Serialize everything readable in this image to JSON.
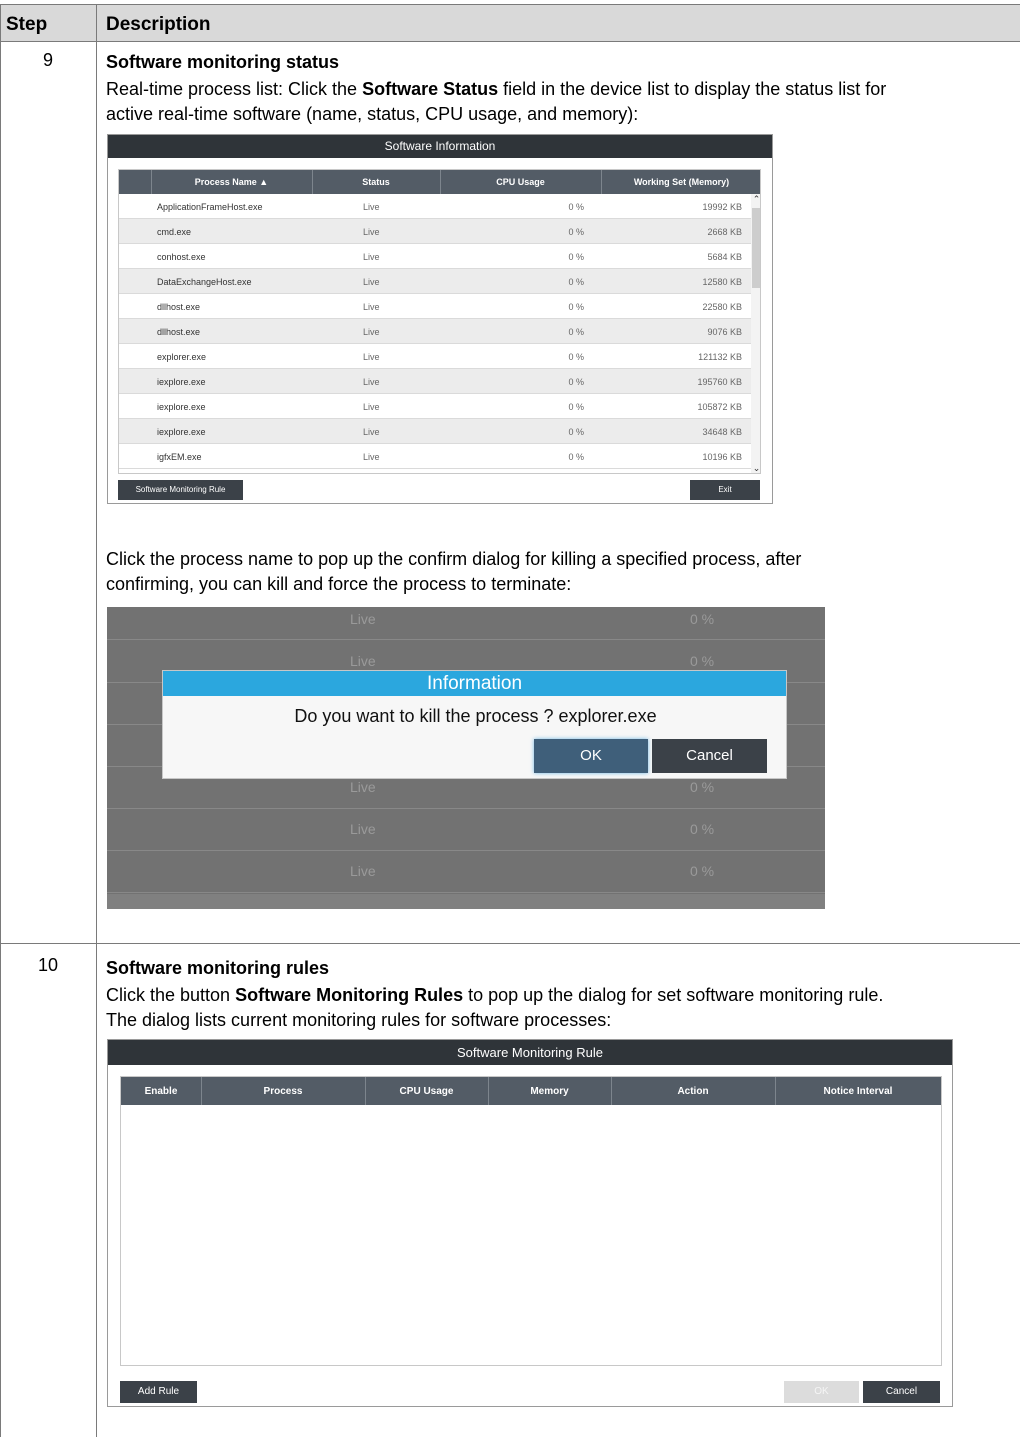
{
  "table_header": {
    "step": "Step",
    "description": "Description"
  },
  "step9": {
    "number": "9",
    "title": "Software monitoring status",
    "p1_a": "Real-time process list: Click the ",
    "p1_b": "Software Status",
    "p1_c": " field in the device list to display the status list for",
    "p1_d": "active real-time software (name, status, CPU usage, and memory):",
    "p2_a": "Click the process name to pop up the confirm dialog for killing a specified process, after",
    "p2_b": "confirming, you can kill and force the process to terminate:"
  },
  "software_info": {
    "title": "Software Information",
    "columns": [
      "Process Name ▲",
      "Status",
      "CPU Usage",
      "Working Set (Memory)"
    ],
    "rows": [
      [
        "ApplicationFrameHost.exe",
        "Live",
        "0 %",
        "19992 KB"
      ],
      [
        "cmd.exe",
        "Live",
        "0 %",
        "2668 KB"
      ],
      [
        "conhost.exe",
        "Live",
        "0 %",
        "5684 KB"
      ],
      [
        "DataExchangeHost.exe",
        "Live",
        "0 %",
        "12580 KB"
      ],
      [
        "dllhost.exe",
        "Live",
        "0 %",
        "22580 KB"
      ],
      [
        "dllhost.exe",
        "Live",
        "0 %",
        "9076 KB"
      ],
      [
        "explorer.exe",
        "Live",
        "0 %",
        "121132 KB"
      ],
      [
        "iexplore.exe",
        "Live",
        "0 %",
        "195760 KB"
      ],
      [
        "iexplore.exe",
        "Live",
        "0 %",
        "105872 KB"
      ],
      [
        "iexplore.exe",
        "Live",
        "0 %",
        "34648 KB"
      ],
      [
        "igfxEM.exe",
        "Live",
        "0 %",
        "10196 KB"
      ]
    ],
    "rule_button": "Software Monitoring Rule",
    "exit_button": "Exit"
  },
  "kill_dialog": {
    "bg_rows": [
      [
        "Live",
        "0 %"
      ],
      [
        "Live",
        "0 %"
      ],
      [
        "Live",
        "0 %"
      ],
      [
        "Live",
        "0 %"
      ],
      [
        "Live",
        "0 %"
      ]
    ],
    "title": "Information",
    "message": "Do you want to kill the process ? explorer.exe",
    "ok": "OK",
    "cancel": "Cancel"
  },
  "step10": {
    "number": "10",
    "title": "Software monitoring rules",
    "p1_a": "Click the button ",
    "p1_b": "Software Monitoring Rules",
    "p1_c": " to pop up the dialog for set software monitoring rule.",
    "p1_d": "The dialog lists current monitoring rules for software processes:"
  },
  "rule_dialog": {
    "title": "Software Monitoring Rule",
    "columns": [
      "Enable",
      "Process",
      "CPU Usage",
      "Memory",
      "Action",
      "Notice Interval"
    ],
    "add_rule": "Add Rule",
    "ok": "OK",
    "cancel": "Cancel"
  },
  "colors": {
    "header_bg": "#d9d9d9",
    "window_titlebar": "#2f3439",
    "grid_header": "#535c66",
    "dialog_title": "#2ba7de",
    "ok_button": "#3f5f7a"
  }
}
